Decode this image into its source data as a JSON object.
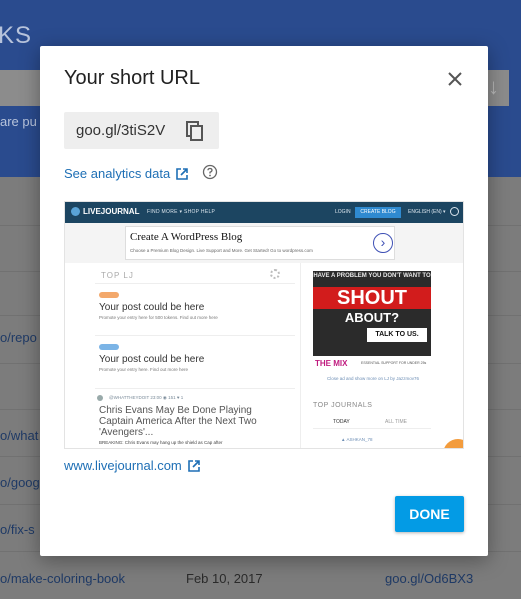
{
  "background": {
    "title": "KS",
    "input_button": "↓",
    "public_text": "are pu",
    "rows": [
      {
        "link": "o/repo"
      },
      {
        "link": "o/what"
      },
      {
        "link": "o/goog"
      },
      {
        "link": "o/fix-s"
      },
      {
        "link": "o/make-coloring-book",
        "date": "Feb 10, 2017",
        "short": "goo.gl/Od6BX3"
      }
    ]
  },
  "dialog": {
    "title": "Your short URL",
    "short_url": "goo.gl/3tiS2V",
    "analytics_label": "See analytics data",
    "site_link": "www.livejournal.com",
    "done_label": "DONE"
  },
  "preview": {
    "logo": "LIVEJOURNAL",
    "nav": "FIND MORE ▾   SHOP   HELP",
    "login": "LOGIN",
    "create": "CREATE BLOG",
    "lang": "ENGLISH (EN) ▾",
    "ad_title": "Create A WordPress Blog",
    "ad_sub": "Choose a Premium Blog Design. Live Support and More. Get Started! Go to wordpress.com",
    "top_label": "TOP LJ",
    "card1_title": "Your post could be here",
    "card1_text": "Promote your entry here for 500 tokens. Find out more here",
    "card2_title": "Your post could be here",
    "card2_text": "Promote your entry here. Find out more here",
    "post_meta": "@WHATTHEYDOIT  23:00  ◉ 151  ♥ 1",
    "post_title": "Chris Evans May Be Done Playing Captain America After the Next Two 'Avengers'...",
    "post_text": "BREAKING: Chris Evans may hang up the shield as Cap after",
    "shout_top": "HAVE A PROBLEM YOU DON'T WANT TO",
    "shout_main": "SHOUT",
    "shout_about": "ABOUT?",
    "shout_talk": "TALK TO US.",
    "mix_logo": "THE MIX",
    "mix_text": "ESSENTIAL SUPPORT FOR UNDER 25s",
    "ad_link": "Close ad and show more on LJ by Jazzmov76",
    "top_journals": "TOP JOURNALS",
    "tab_today": "TODAY",
    "tab_all": "ALL TIME",
    "tj_row": "▲ ASHKAN_78"
  }
}
